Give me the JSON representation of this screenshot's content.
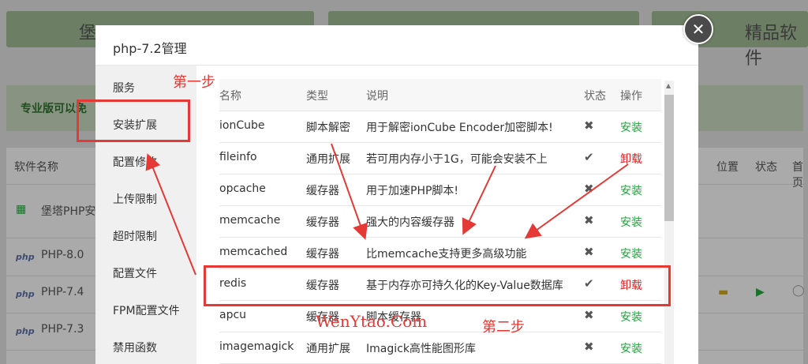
{
  "modal": {
    "title": "php-7.2管理",
    "close_icon": "close-icon",
    "side_menu": [
      "服务",
      "安装扩展",
      "配置修改",
      "上传限制",
      "超时限制",
      "配置文件",
      "FPM配置文件",
      "禁用函数"
    ],
    "selected_menu": "安装扩展",
    "table": {
      "headers": [
        "名称",
        "类型",
        "说明",
        "状态",
        "操作"
      ],
      "rows": [
        {
          "name": "ionCube",
          "type": "脚本解密",
          "desc": "用于解密ionCube Encoder加密脚本!",
          "status": "✖",
          "action": "安装"
        },
        {
          "name": "fileinfo",
          "type": "通用扩展",
          "desc": "若可用内存小于1G，可能会安装不上",
          "status": "✔",
          "action": "卸载"
        },
        {
          "name": "opcache",
          "type": "缓存器",
          "desc": "用于加速PHP脚本!",
          "status": "✖",
          "action": "安装"
        },
        {
          "name": "memcache",
          "type": "缓存器",
          "desc": "强大的内容缓存器",
          "status": "✖",
          "action": "安装"
        },
        {
          "name": "memcached",
          "type": "缓存器",
          "desc": "比memcache支持更多高级功能",
          "status": "✖",
          "action": "安装"
        },
        {
          "name": "redis",
          "type": "缓存器",
          "desc": "基于内存亦可持久化的Key-Value数据库",
          "status": "✔",
          "action": "卸载"
        },
        {
          "name": "apcu",
          "type": "缓存器",
          "desc": "脚本缓存器",
          "status": "✖",
          "action": "安装"
        },
        {
          "name": "imagemagick",
          "type": "通用扩展",
          "desc": "Imagick高性能图形库",
          "status": "✖",
          "action": "安装"
        }
      ]
    }
  },
  "annotations": {
    "step1": "第一步",
    "step2": "第二步",
    "watermark": "WenYtao.Com"
  },
  "background": {
    "card_left": "堡",
    "card_right": "精品软件",
    "banner": "专业版可以免",
    "table_header_left": "软件名称",
    "table_header_right": [
      "位置",
      "状态",
      "首页"
    ],
    "first_row": "堡塔PHP安",
    "php_rows": [
      "PHP-8.0",
      "PHP-7.4",
      "PHP-7.3"
    ],
    "php_tag": "php"
  },
  "colors": {
    "install": "#20a53a",
    "uninstall": "#e02020",
    "annotation": "#e53935"
  }
}
